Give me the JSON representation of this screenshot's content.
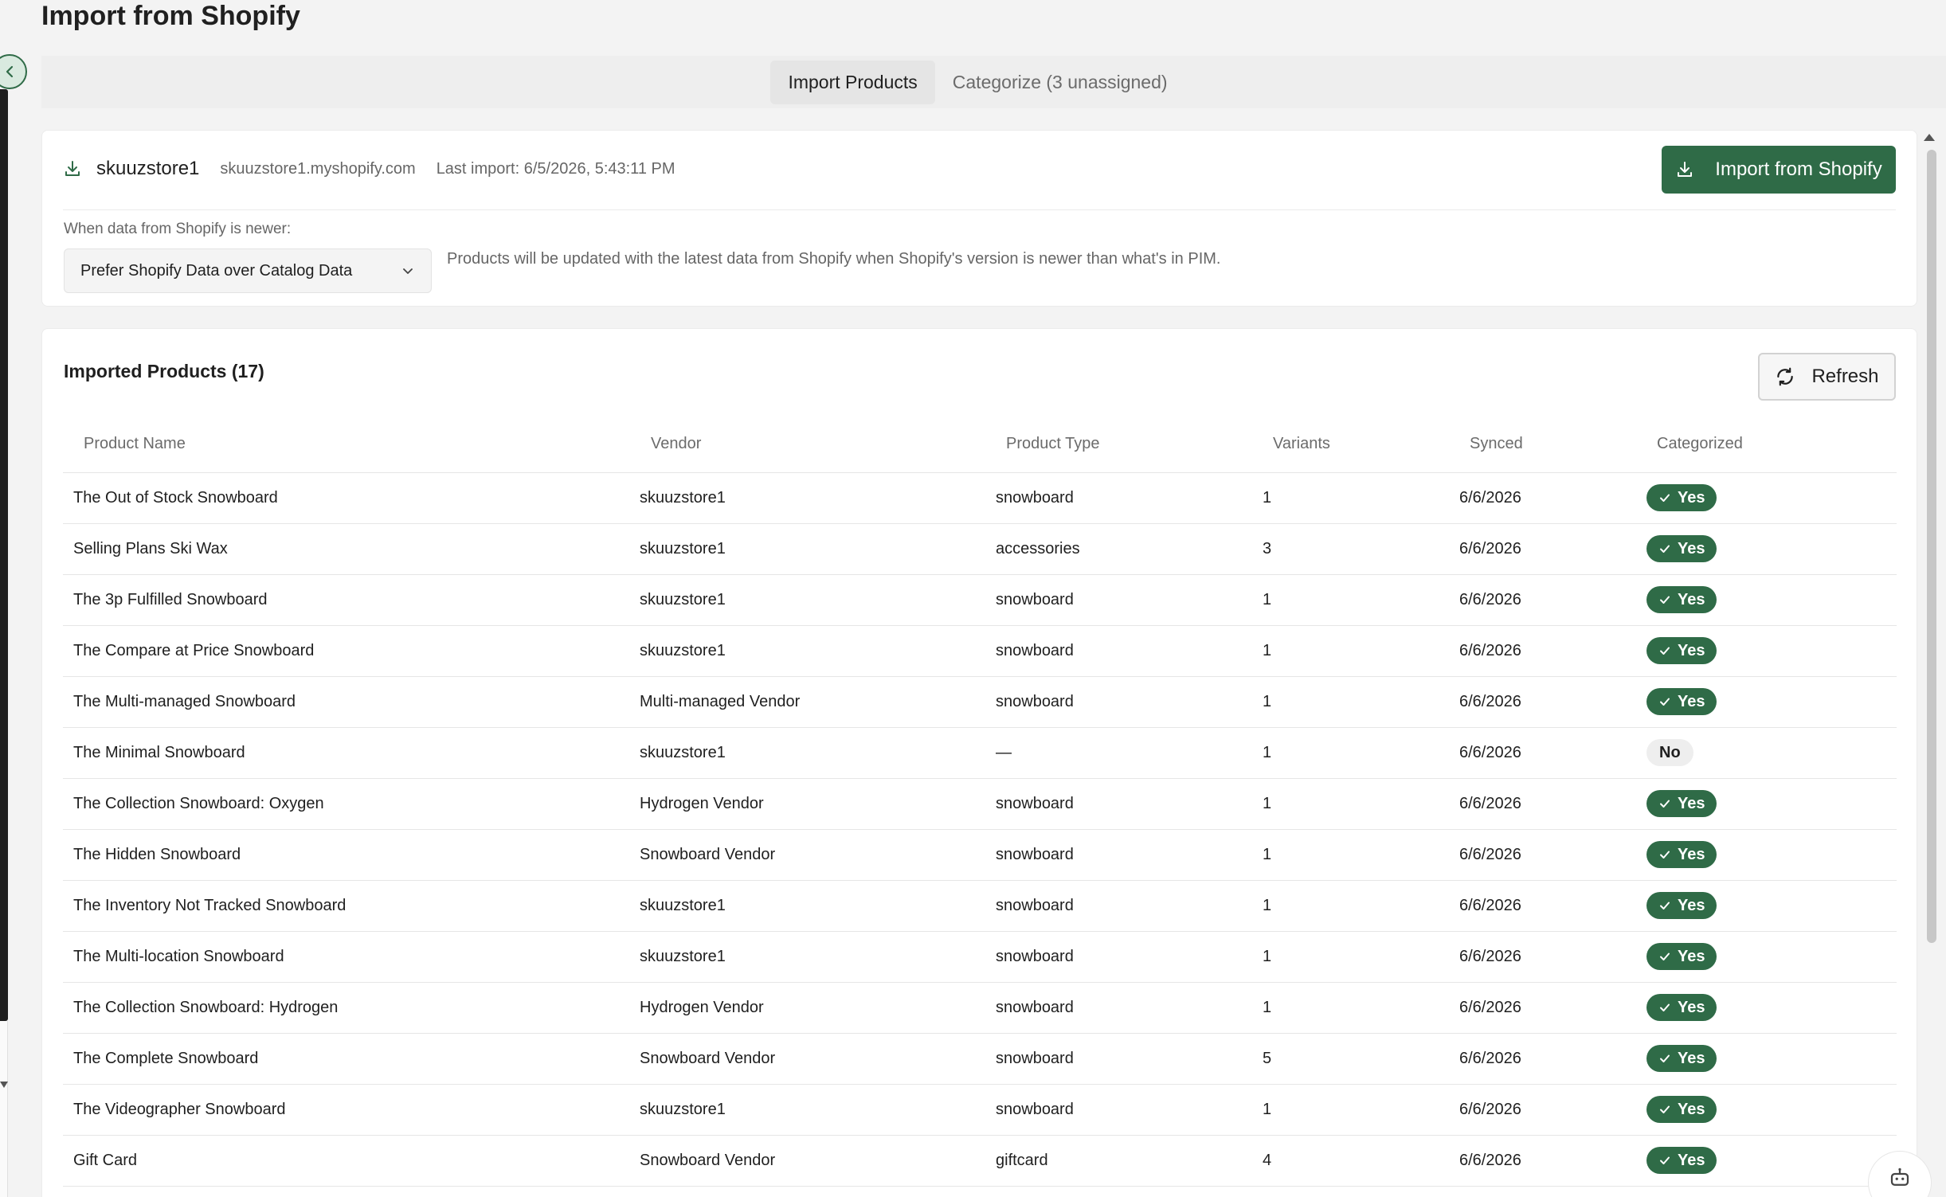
{
  "page": {
    "title": "Import from Shopify"
  },
  "tabs": [
    {
      "label": "Import Products",
      "active": true
    },
    {
      "label": "Categorize (3 unassigned)",
      "active": false
    }
  ],
  "shopify": {
    "store_name": "skuuzstore1",
    "store_url": "skuuzstore1.myshopify.com",
    "last_import": "Last import: 6/5/2026, 5:43:11 PM",
    "import_button": "Import from Shopify",
    "when_label": "When data from Shopify is newer:",
    "select_value": "Prefer Shopify Data over Catalog Data",
    "select_help": "Products will be updated with the latest data from Shopify when Shopify's version is newer than what's in PIM."
  },
  "products": {
    "title": "Imported Products (17)",
    "refresh_button": "Refresh",
    "columns": [
      "Product Name",
      "Vendor",
      "Product Type",
      "Variants",
      "Synced",
      "Categorized"
    ],
    "rows": [
      {
        "name": "The Out of Stock Snowboard",
        "vendor": "skuuzstore1",
        "type": "snowboard",
        "variants": "1",
        "synced": "6/6/2026",
        "categorized": "Yes"
      },
      {
        "name": "Selling Plans Ski Wax",
        "vendor": "skuuzstore1",
        "type": "accessories",
        "variants": "3",
        "synced": "6/6/2026",
        "categorized": "Yes"
      },
      {
        "name": "The 3p Fulfilled Snowboard",
        "vendor": "skuuzstore1",
        "type": "snowboard",
        "variants": "1",
        "synced": "6/6/2026",
        "categorized": "Yes"
      },
      {
        "name": "The Compare at Price Snowboard",
        "vendor": "skuuzstore1",
        "type": "snowboard",
        "variants": "1",
        "synced": "6/6/2026",
        "categorized": "Yes"
      },
      {
        "name": "The Multi-managed Snowboard",
        "vendor": "Multi-managed Vendor",
        "type": "snowboard",
        "variants": "1",
        "synced": "6/6/2026",
        "categorized": "Yes"
      },
      {
        "name": "The Minimal Snowboard",
        "vendor": "skuuzstore1",
        "type": "—",
        "variants": "1",
        "synced": "6/6/2026",
        "categorized": "No"
      },
      {
        "name": "The Collection Snowboard: Oxygen",
        "vendor": "Hydrogen Vendor",
        "type": "snowboard",
        "variants": "1",
        "synced": "6/6/2026",
        "categorized": "Yes"
      },
      {
        "name": "The Hidden Snowboard",
        "vendor": "Snowboard Vendor",
        "type": "snowboard",
        "variants": "1",
        "synced": "6/6/2026",
        "categorized": "Yes"
      },
      {
        "name": "The Inventory Not Tracked Snowboard",
        "vendor": "skuuzstore1",
        "type": "snowboard",
        "variants": "1",
        "synced": "6/6/2026",
        "categorized": "Yes"
      },
      {
        "name": "The Multi-location Snowboard",
        "vendor": "skuuzstore1",
        "type": "snowboard",
        "variants": "1",
        "synced": "6/6/2026",
        "categorized": "Yes"
      },
      {
        "name": "The Collection Snowboard: Hydrogen",
        "vendor": "Hydrogen Vendor",
        "type": "snowboard",
        "variants": "1",
        "synced": "6/6/2026",
        "categorized": "Yes"
      },
      {
        "name": "The Complete Snowboard",
        "vendor": "Snowboard Vendor",
        "type": "snowboard",
        "variants": "5",
        "synced": "6/6/2026",
        "categorized": "Yes"
      },
      {
        "name": "The Videographer Snowboard",
        "vendor": "skuuzstore1",
        "type": "snowboard",
        "variants": "1",
        "synced": "6/6/2026",
        "categorized": "Yes"
      },
      {
        "name": "Gift Card",
        "vendor": "Snowboard Vendor",
        "type": "giftcard",
        "variants": "4",
        "synced": "6/6/2026",
        "categorized": "Yes"
      }
    ]
  },
  "colors": {
    "accent": "#2f6b47",
    "muted_text": "#6b6b6b",
    "background": "#f3f3f3"
  },
  "icons": {
    "collapse": "chevron-left-icon",
    "store": "download-icon",
    "import": "download-icon",
    "select": "chevron-down-icon",
    "refresh": "refresh-icon",
    "badge_yes": "check-icon",
    "assistant": "robot-icon"
  }
}
